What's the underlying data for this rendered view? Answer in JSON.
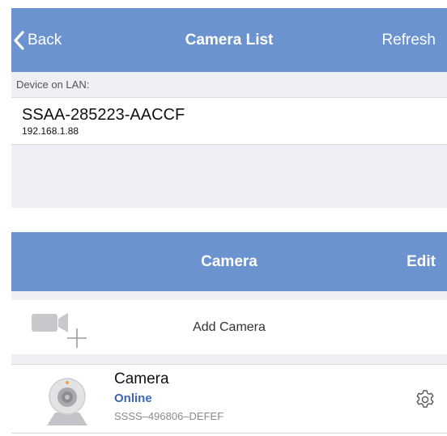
{
  "navbar": {
    "back_label": "Back",
    "title": "Camera List",
    "refresh_label": "Refresh"
  },
  "lan_section": {
    "header": "Device on LAN:"
  },
  "lan_device": {
    "name": "SSAA-285223-AACCF",
    "ip": "192.168.1.88"
  },
  "camera_section": {
    "title": "Camera",
    "edit_label": "Edit"
  },
  "add_camera": {
    "label": "Add Camera",
    "icon": "video-add-icon"
  },
  "cameras": [
    {
      "name": "Camera",
      "status": "Online",
      "uid": "SSSS–496806–DEFEF"
    }
  ],
  "colors": {
    "bar": "#6b93cf",
    "online": "#3a66b3",
    "background": "#efeff4"
  }
}
